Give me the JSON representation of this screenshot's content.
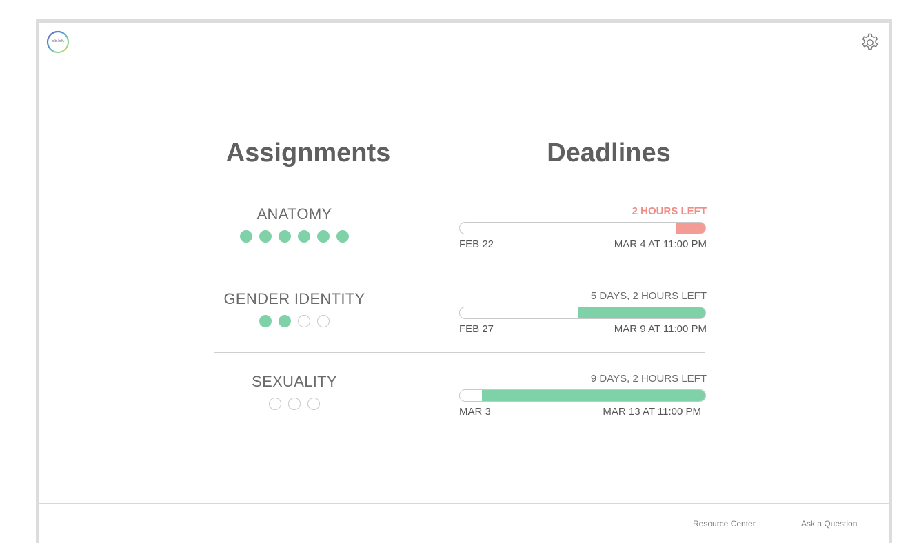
{
  "app": {
    "logo_text": "SEEK"
  },
  "headings": {
    "assignments": "Assignments",
    "deadlines": "Deadlines"
  },
  "assignments": [
    {
      "subject": "ANATOMY",
      "dots_filled": 6,
      "dots_total": 6,
      "time_left": "2 HOURS LEFT",
      "urgent": true,
      "start_date": "FEB 22",
      "end_date": "MAR 4 AT 11:00 PM",
      "remaining_fraction": 0.12,
      "fill_color": "#f49b95"
    },
    {
      "subject": "GENDER IDENTITY",
      "dots_filled": 2,
      "dots_total": 4,
      "time_left": "5 DAYS, 2 HOURS LEFT",
      "urgent": false,
      "start_date": "FEB 27",
      "end_date": "MAR 9 AT 11:00 PM",
      "remaining_fraction": 0.52,
      "fill_color": "#7fd1a8"
    },
    {
      "subject": "SEXUALITY",
      "dots_filled": 0,
      "dots_total": 3,
      "time_left": "9 DAYS, 2 HOURS LEFT",
      "urgent": false,
      "start_date": "MAR 3",
      "end_date": "MAR 13 AT 11:00 PM",
      "remaining_fraction": 0.91,
      "fill_color": "#7fd1a8"
    }
  ],
  "footer": {
    "resource_center": "Resource Center",
    "ask_question": "Ask a Question"
  },
  "icons": {
    "settings": "gear-icon",
    "logo": "seek-logo"
  },
  "colors": {
    "accent_green": "#7fd1a8",
    "urgent_red": "#f08b85"
  }
}
